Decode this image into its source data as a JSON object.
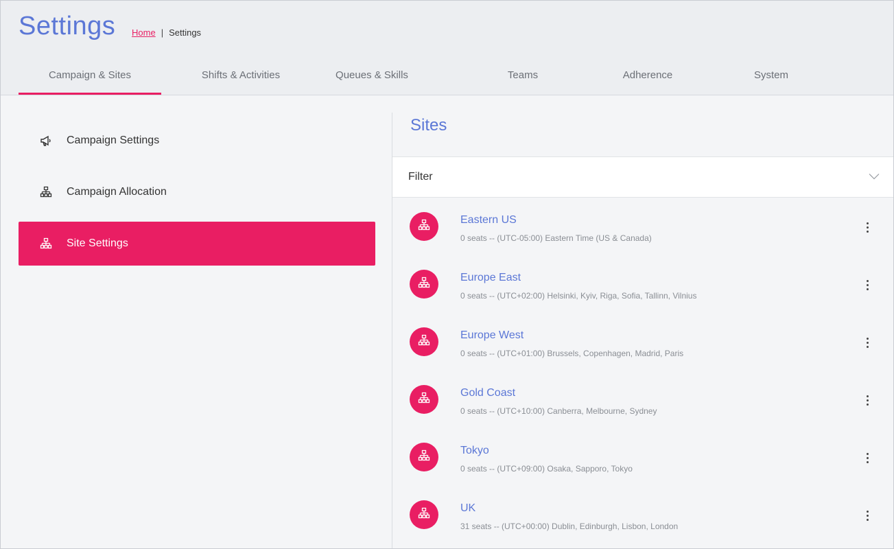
{
  "header": {
    "title": "Settings",
    "breadcrumb": {
      "home": "Home",
      "separator": "|",
      "current": "Settings"
    }
  },
  "tabs": [
    {
      "label": "Campaign & Sites",
      "active": true
    },
    {
      "label": "Shifts & Activities",
      "active": false
    },
    {
      "label": "Queues & Skills",
      "active": false
    },
    {
      "label": "Teams",
      "active": false
    },
    {
      "label": "Adherence",
      "active": false
    },
    {
      "label": "System",
      "active": false
    }
  ],
  "sidebar": {
    "items": [
      {
        "label": "Campaign Settings",
        "icon": "megaphone-icon",
        "active": false
      },
      {
        "label": "Campaign Allocation",
        "icon": "sitemap-icon",
        "active": false
      },
      {
        "label": "Site Settings",
        "icon": "sitemap-icon",
        "active": true
      }
    ]
  },
  "main": {
    "title": "Sites",
    "filter_label": "Filter",
    "sites": [
      {
        "name": "Eastern US",
        "desc": "0 seats -- (UTC-05:00) Eastern Time (US & Canada)"
      },
      {
        "name": "Europe East",
        "desc": "0 seats -- (UTC+02:00) Helsinki, Kyiv, Riga, Sofia, Tallinn, Vilnius"
      },
      {
        "name": "Europe West",
        "desc": "0 seats -- (UTC+01:00) Brussels, Copenhagen, Madrid, Paris"
      },
      {
        "name": "Gold Coast",
        "desc": "0 seats -- (UTC+10:00) Canberra, Melbourne, Sydney"
      },
      {
        "name": "Tokyo",
        "desc": "0 seats -- (UTC+09:00) Osaka, Sapporo, Tokyo"
      },
      {
        "name": "UK",
        "desc": "31 seats -- (UTC+00:00) Dublin, Edinburgh, Lisbon, London"
      }
    ]
  },
  "colors": {
    "accent": "#e91e63",
    "title": "#5b77d6",
    "header_bg": "#eceef1",
    "page_bg": "#f4f5f7"
  }
}
